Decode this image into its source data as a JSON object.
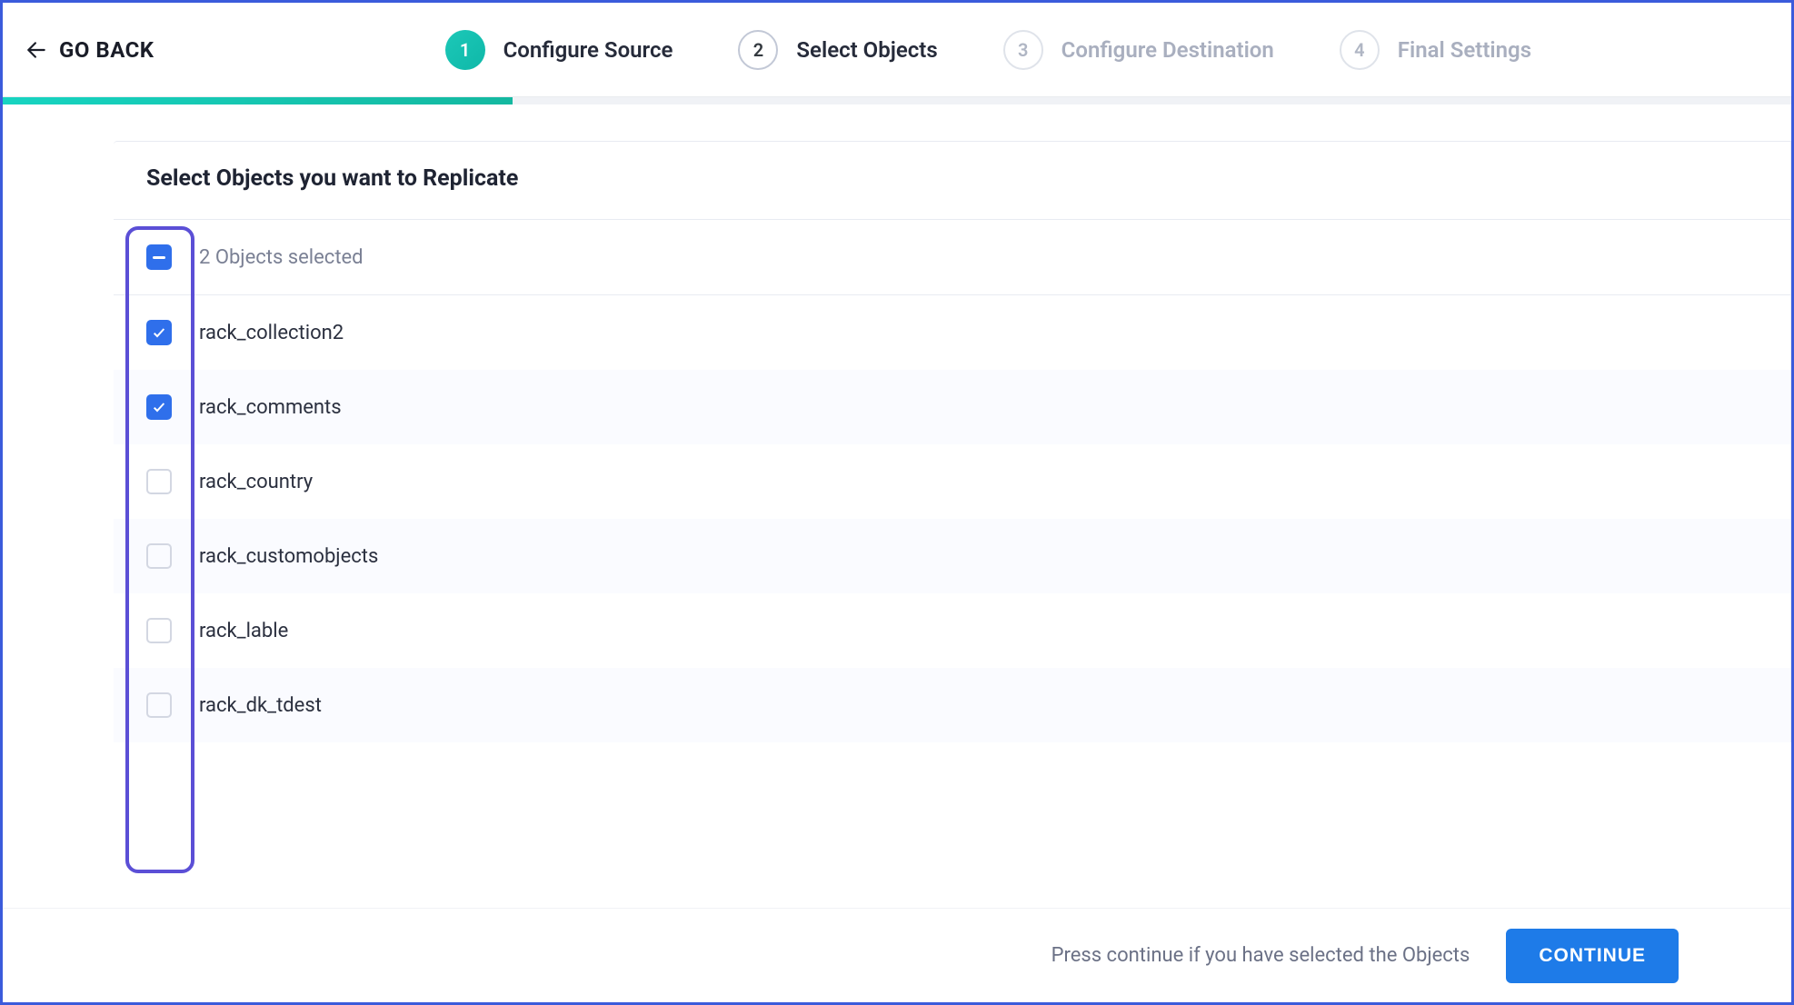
{
  "header": {
    "go_back_label": "GO BACK",
    "steps": [
      {
        "num": "1",
        "label": "Configure Source",
        "state": "active"
      },
      {
        "num": "2",
        "label": "Select Objects",
        "state": "next"
      },
      {
        "num": "3",
        "label": "Configure Destination",
        "state": "future"
      },
      {
        "num": "4",
        "label": "Final Settings",
        "state": "future"
      }
    ]
  },
  "card_title": "Select Objects you want to Replicate",
  "selection_summary": "2 Objects selected",
  "objects": [
    {
      "name": "rack_collection2",
      "checked": true
    },
    {
      "name": "rack_comments",
      "checked": true
    },
    {
      "name": "rack_country",
      "checked": false
    },
    {
      "name": "rack_customobjects",
      "checked": false
    },
    {
      "name": "rack_lable",
      "checked": false
    },
    {
      "name": "rack_dk_tdest",
      "checked": false
    }
  ],
  "footer": {
    "hint": "Press continue if you have selected the Objects",
    "continue_label": "CONTINUE"
  }
}
